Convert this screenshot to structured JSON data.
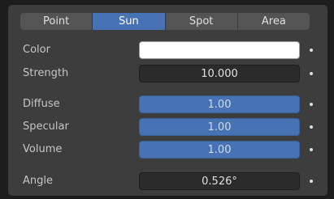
{
  "tabs": [
    "Point",
    "Sun",
    "Spot",
    "Area"
  ],
  "active_tab": "Sun",
  "properties": {
    "color": {
      "label": "Color",
      "value_color": "#ffffff"
    },
    "strength": {
      "label": "Strength",
      "value": "10.000"
    },
    "diffuse": {
      "label": "Diffuse",
      "value": "1.00"
    },
    "specular": {
      "label": "Specular",
      "value": "1.00"
    },
    "volume": {
      "label": "Volume",
      "value": "1.00"
    },
    "angle": {
      "label": "Angle",
      "value": "0.526°"
    }
  },
  "colors": {
    "accent": "#4772b3",
    "panel": "#3d3d3d",
    "field": "#2b2b2b"
  }
}
